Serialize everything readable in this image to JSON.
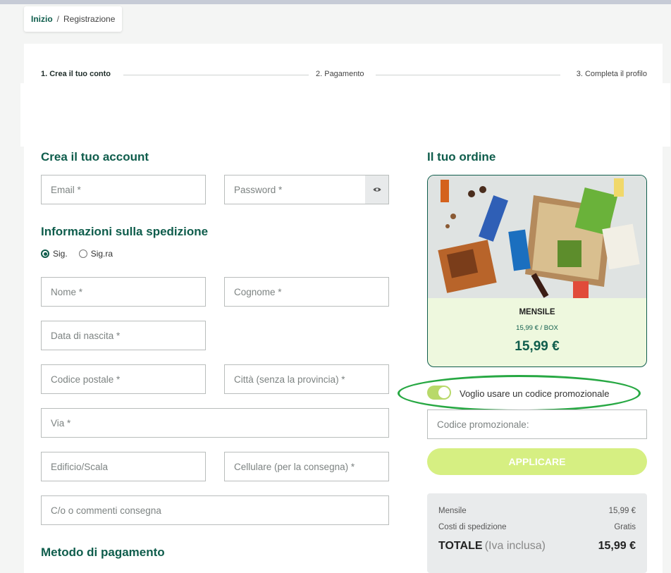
{
  "breadcrumb": {
    "home": "Inizio",
    "separator": "/",
    "current": "Registrazione"
  },
  "steps": [
    "1. Crea il tuo conto",
    "2. Pagamento",
    "3. Completa il profilo"
  ],
  "account": {
    "title": "Crea il tuo account",
    "email_placeholder": "Email *",
    "password_placeholder": "Password *"
  },
  "shipping": {
    "title": "Informazioni sulla spedizione",
    "salutation": {
      "options": [
        "Sig.",
        "Sig.ra"
      ],
      "selected": "Sig."
    },
    "nome": "Nome *",
    "cognome": "Cognome *",
    "data_nascita": "Data di nascita *",
    "codice_postale": "Codice postale *",
    "citta": "Città (senza la provincia) *",
    "via": "Via *",
    "edificio": "Edificio/Scala",
    "cellulare": "Cellulare (per la consegna) *",
    "commenti": "C/o o commenti consegna"
  },
  "payment": {
    "title": "Metodo di pagamento"
  },
  "order": {
    "title": "Il tuo ordine",
    "plan_name": "MENSILE",
    "plan_sub": "15,99 € / BOX",
    "plan_price": "15,99 €"
  },
  "promo": {
    "toggle_label": "Voglio usare un codice promozionale",
    "toggle_on": true,
    "input_placeholder": "Codice promozionale:",
    "apply_label": "APPLICARE"
  },
  "summary": {
    "rows": [
      {
        "label": "Mensile",
        "value": "15,99 €"
      },
      {
        "label": "Costi di spedizione",
        "value": "Gratis"
      }
    ],
    "total_label": "TOTALE",
    "total_sub": "(Iva inclusa)",
    "total_value": "15,99 €"
  },
  "colors": {
    "brand": "#0f5d4c",
    "accent": "#d6ef82",
    "highlight": "#27a843"
  }
}
